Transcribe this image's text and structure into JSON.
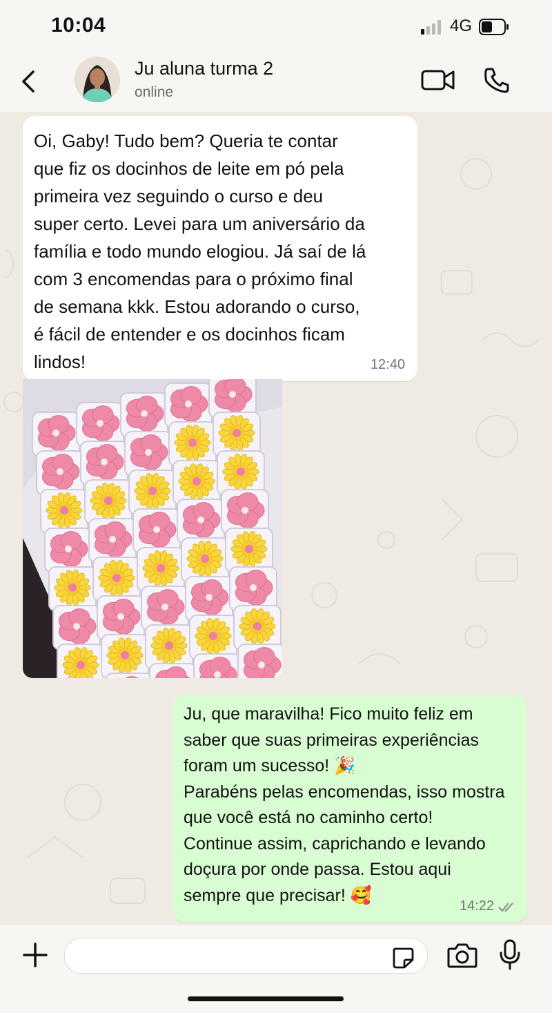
{
  "status_bar": {
    "time": "10:04",
    "network": "4G"
  },
  "header": {
    "contact_name": "Ju aluna turma 2",
    "contact_status": "online"
  },
  "messages": [
    {
      "direction": "incoming",
      "text": "Oi, Gaby! Tudo bem? Queria te contar\nque fiz os docinhos de leite em pó pela\nprimeira vez seguindo o curso e deu\nsuper certo. Levei para um aniversário da\nfamília e todo mundo elogiou. Já saí de lá\ncom 3 encomendas para o próximo final\nde semana kkk. Estou adorando o curso,\né fácil de entender e os docinhos ficam\nlindos!",
      "time": "12:40"
    },
    {
      "direction": "incoming",
      "type": "image"
    },
    {
      "direction": "outgoing",
      "text": "Ju, que maravilha! Fico muito feliz em\nsaber que suas primeiras experiências\nforam um sucesso! 🎉\nParabéns pelas encomendas, isso mostra\nque você está no caminho certo!\nContinue assim, caprichando e levando\ndoçura por onde passa. Estou aqui\nsempre que precisar! 🥰",
      "time": "14:22",
      "status": "read"
    }
  ],
  "composer": {
    "placeholder": ""
  },
  "colors": {
    "chat_background": "#efeae2",
    "incoming_bubble": "#ffffff",
    "outgoing_bubble": "#d9fdd3",
    "bar_background": "#f7f6f3",
    "pink_sweet": "#ee8aa8",
    "yellow_sweet": "#f8d63c"
  },
  "icons": [
    "back-icon",
    "video-call-icon",
    "phone-icon",
    "plus-icon",
    "sticker-icon",
    "camera-icon",
    "mic-icon",
    "read-ticks-icon",
    "signal-icon",
    "battery-icon"
  ]
}
